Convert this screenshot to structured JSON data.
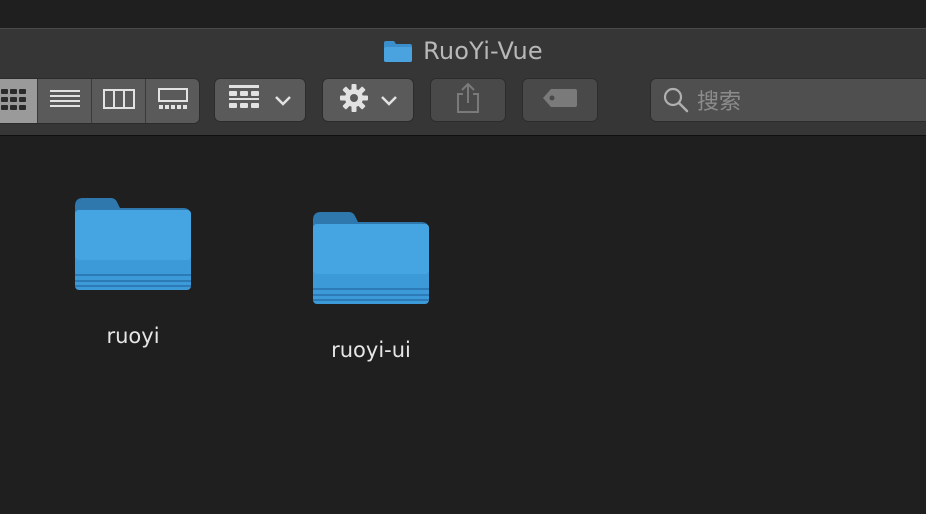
{
  "window": {
    "title": "RuoYi-Vue",
    "title_icon": "folder-icon"
  },
  "toolbar": {
    "view_modes": [
      {
        "name": "icon-view",
        "icon": "grid-icon",
        "active": true
      },
      {
        "name": "list-view",
        "icon": "list-icon",
        "active": false
      },
      {
        "name": "column-view",
        "icon": "columns-icon",
        "active": false
      },
      {
        "name": "gallery-view",
        "icon": "gallery-icon",
        "active": false
      }
    ],
    "group_button_icon": "group-grid-icon",
    "action_button_icon": "gear-icon",
    "share_button_icon": "share-icon",
    "tag_button_icon": "tag-icon"
  },
  "search": {
    "placeholder": "搜索",
    "icon": "magnifier-icon"
  },
  "items": [
    {
      "label": "ruoyi",
      "type": "folder"
    },
    {
      "label": "ruoyi-ui",
      "type": "folder"
    }
  ],
  "colors": {
    "background": "#1f1f1f",
    "toolbar": "#363636",
    "folder_blue": "#3a9ad9",
    "text": "#e6e6e6"
  }
}
